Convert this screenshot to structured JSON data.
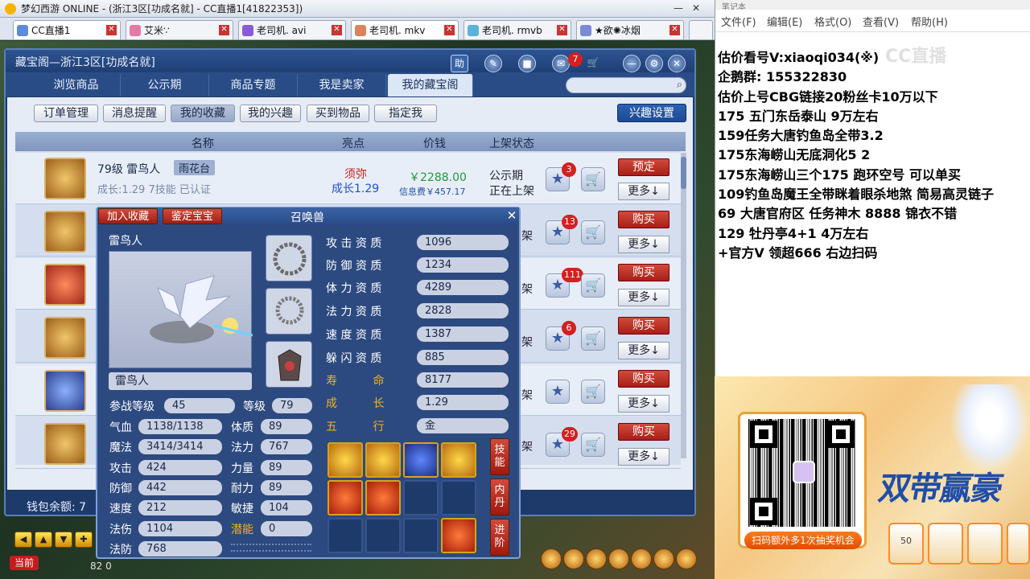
{
  "window": {
    "title": "梦幻西游 ONLINE - (浙江3区[功成名就] - CC直播1[41822353])"
  },
  "tabs": [
    {
      "label": "CC直播1"
    },
    {
      "label": "艾米∵"
    },
    {
      "label": "老司机. avi"
    },
    {
      "label": "老司机. mkv"
    },
    {
      "label": "老司机. rmvb"
    },
    {
      "label": "★欲✺冰烟"
    }
  ],
  "cbg": {
    "title": "藏宝阁—浙江3区[功成名就]",
    "help_label": "助",
    "message_count": "7",
    "main_tabs": [
      "浏览商品",
      "公示期",
      "商品专题",
      "我是卖家",
      "我的藏宝阁"
    ],
    "sub_tabs": [
      "订单管理",
      "消息提醒",
      "我的收藏",
      "我的兴趣",
      "买到物品",
      "指定我"
    ],
    "interest_button": "兴趣设置",
    "columns": [
      "名称",
      "亮点",
      "价钱",
      "上架状态"
    ],
    "wallet_label": "钱包余额: 7",
    "first_row": {
      "name": "79级 雷鸟人",
      "server": "雨花台",
      "meta": "成长:1.29 7技能 已认证",
      "highlight1": "须弥",
      "highlight2": "成长1.29",
      "price": "￥2288.00",
      "fee": "信息费￥457.17",
      "status1": "公示期",
      "status2": "正在上架",
      "star_count": "3",
      "action": "预定",
      "more": "更多↓"
    },
    "rows": [
      {
        "shelf": "架",
        "star_count": "13",
        "action": "购买",
        "more": "更多↓"
      },
      {
        "shelf": "架",
        "star_count": "111",
        "action": "购买",
        "more": "更多↓"
      },
      {
        "shelf": "架",
        "star_count": "6",
        "action": "购买",
        "more": "更多↓"
      },
      {
        "shelf": "架",
        "star_count": "",
        "action": "购买",
        "more": "更多↓"
      },
      {
        "shelf": "架",
        "star_count": "29",
        "action": "购买",
        "more": "更多↓"
      }
    ]
  },
  "popup": {
    "btn_favorite": "加入收藏",
    "btn_appraise": "鉴定宝宝",
    "title": "召唤兽",
    "close": "✕",
    "pet_name": "雷鸟人",
    "name_field": "雷鸟人",
    "battle_level_label": "参战等级",
    "battle_level": "45",
    "level_label": "等级",
    "level": "79",
    "stats_left": [
      {
        "label": "气血",
        "value": "1138/1138"
      },
      {
        "label": "魔法",
        "value": "3414/3414"
      },
      {
        "label": "攻击",
        "value": "424"
      },
      {
        "label": "防御",
        "value": "442"
      },
      {
        "label": "速度",
        "value": "212"
      },
      {
        "label": "法伤",
        "value": "1104"
      },
      {
        "label": "法防",
        "value": "768"
      }
    ],
    "stats_mid": [
      {
        "label": "体质",
        "value": "89"
      },
      {
        "label": "法力",
        "value": "767"
      },
      {
        "label": "力量",
        "value": "89"
      },
      {
        "label": "耐力",
        "value": "89"
      },
      {
        "label": "敏捷",
        "value": "104"
      },
      {
        "label": "潜能",
        "value": "0"
      }
    ],
    "aptitudes": [
      {
        "label": "攻 击 资 质",
        "value": "1096"
      },
      {
        "label": "防 御 资 质",
        "value": "1234"
      },
      {
        "label": "体 力 资 质",
        "value": "4289"
      },
      {
        "label": "法 力 资 质",
        "value": "2828"
      },
      {
        "label": "速 度 资 质",
        "value": "1387"
      },
      {
        "label": "躲 闪 资 质",
        "value": "885"
      },
      {
        "label": "寿          命",
        "value": "8177"
      },
      {
        "label": "成          长",
        "value": "1.29"
      },
      {
        "label": "五          行",
        "value": "金"
      }
    ],
    "side_buttons": [
      "技能",
      "内丹",
      "进阶"
    ]
  },
  "toolbar": {
    "current": "当前",
    "coords": "82 0"
  },
  "notepad": {
    "title": "笔记本",
    "menu": [
      "文件(F)",
      "编辑(E)",
      "格式(O)",
      "查看(V)",
      "帮助(H)"
    ],
    "lines": [
      "估价看号V:xiaoqi034(※)",
      "企鹅群:  155322830",
      "估价上号CBG链接20粉丝卡10万以下",
      "175 五门东岳泰山  9万左右",
      "159任务大唐钓鱼岛全带3.2",
      "175东海崂山无底洞化5  2",
      "175东海崂山三个175 跑环空号 可以单买",
      "109钓鱼岛魔王全带眯着眼杀地煞 简易高灵链子",
      "69  大唐官府区 任务神木 8888 锦衣不错",
      "129 牡丹亭4+1 4万左右",
      "+官方V 领超666 右边扫码"
    ],
    "watermark": "CC直播"
  },
  "ad": {
    "banner": "扫码额外多1次抽奖机会",
    "headline": "双带赢豪",
    "prize_label": "50"
  }
}
